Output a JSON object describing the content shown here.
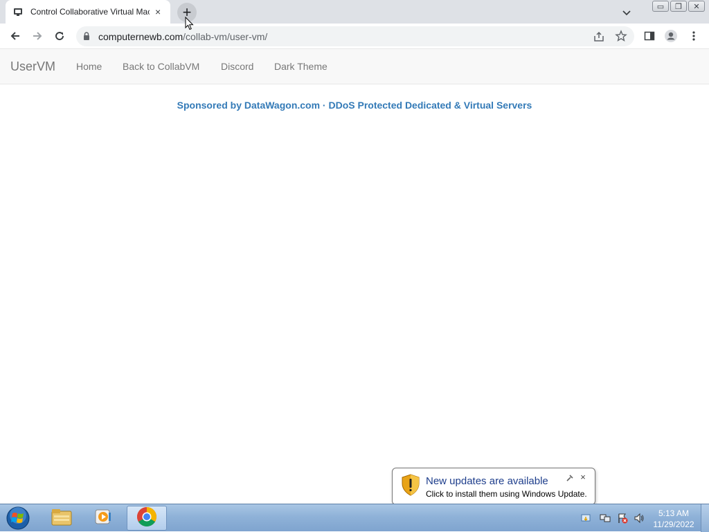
{
  "browser": {
    "tab_title": "Control Collaborative Virtual Machines",
    "tab_close": "×",
    "new_tab": "+",
    "url_host": "computernewb.com",
    "url_path": "/collab-vm/user-vm/",
    "window_controls": [
      "▭",
      "❐",
      "✕"
    ]
  },
  "page": {
    "brand": "UserVM",
    "nav": [
      "Home",
      "Back to CollabVM",
      "Discord",
      "Dark Theme"
    ],
    "sponsor": "Sponsored by DataWagon.com · DDoS Protected Dedicated & Virtual Servers"
  },
  "notification": {
    "title": "New updates are available",
    "text": "Click to install them using Windows Update.",
    "close": "×"
  },
  "taskbar": {
    "time": "5:13 AM",
    "date": "11/29/2022"
  },
  "colors": {
    "link": "#337ab7",
    "nav_text": "#777777",
    "taskbar": "#8fb2d8"
  }
}
